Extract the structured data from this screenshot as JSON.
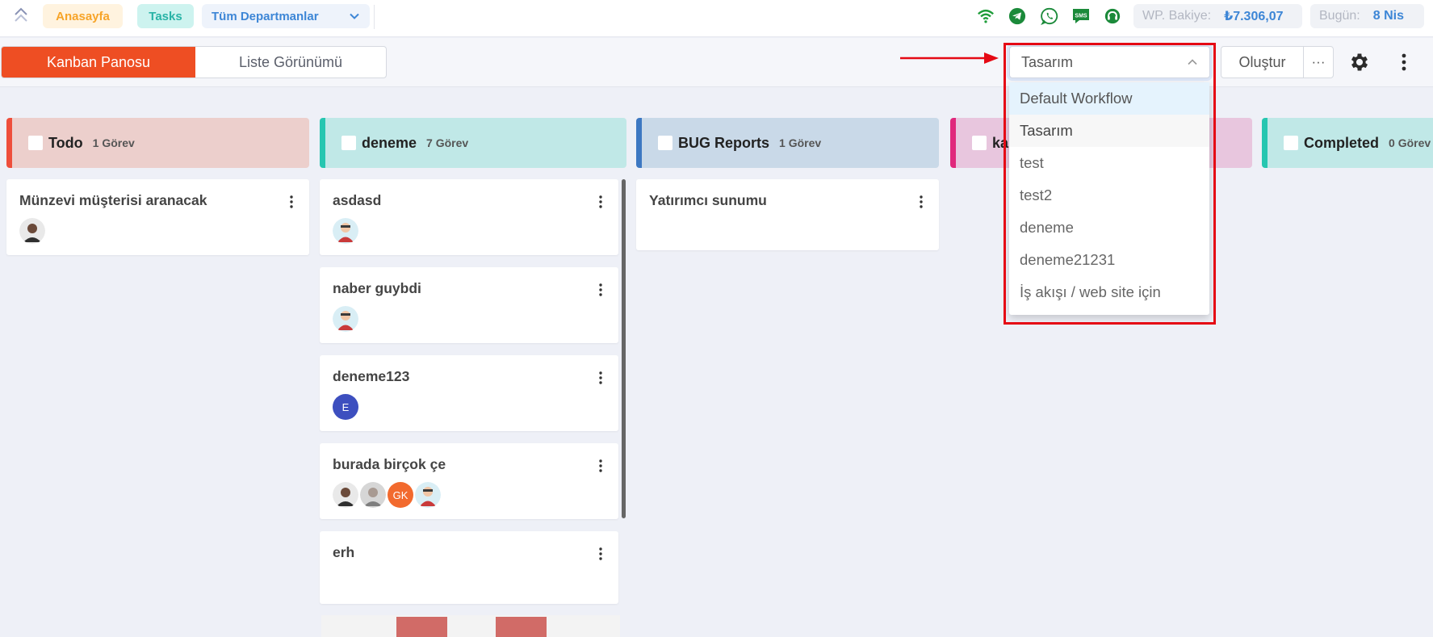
{
  "header": {
    "breadcrumbs": {
      "home": "Anasayfa",
      "tasks": "Tasks",
      "department": "Tüm Departmanlar"
    },
    "icons": [
      "wifi-icon",
      "telegram-icon",
      "whatsapp-icon",
      "sms-icon",
      "support-icon"
    ],
    "wp_balance": {
      "label": "WP. Bakiye:",
      "value": "₺7.306,07"
    },
    "today": {
      "label": "Bugün:",
      "value": "8 Nis"
    }
  },
  "toolbar": {
    "views": {
      "kanban": "Kanban Panosu",
      "list": "Liste Görünümü"
    },
    "workflow_selected": "Tasarım",
    "create_label": "Oluştur",
    "more_label": "···"
  },
  "workflow_dropdown": {
    "options": [
      "Default Workflow",
      "Tasarım",
      "test",
      "test2",
      "deneme",
      "deneme21231",
      "İş akışı / web site için"
    ]
  },
  "columns": [
    {
      "name": "Todo",
      "count": "1 Görev",
      "color": "#ee4e3b",
      "bg": "#eccfcc",
      "cards": [
        {
          "title": "Münzevi müşterisi aranacak"
        }
      ]
    },
    {
      "name": "deneme",
      "count": "7 Görev",
      "color": "#26c6b0",
      "bg": "#c0e8e7",
      "cards": [
        {
          "title": "asdasd"
        },
        {
          "title": "naber guybdi"
        },
        {
          "title": "deneme123",
          "avatar_letter": "E"
        },
        {
          "title": "burada birçok çe",
          "avatar_initials": "GK"
        },
        {
          "title": "erh"
        }
      ]
    },
    {
      "name": "BUG Reports",
      "count": "1 Görev",
      "color": "#3d78c2",
      "bg": "#c9d9e8",
      "cards": [
        {
          "title": "Yatırımcı sunumu"
        }
      ]
    },
    {
      "name": "ka",
      "count": "",
      "color": "#e0287c",
      "bg": "#e8c6de",
      "cards": []
    },
    {
      "name": "Completed",
      "count": "0 Görev",
      "color": "#26c6b0",
      "bg": "#c0e8e7",
      "cards": []
    }
  ]
}
